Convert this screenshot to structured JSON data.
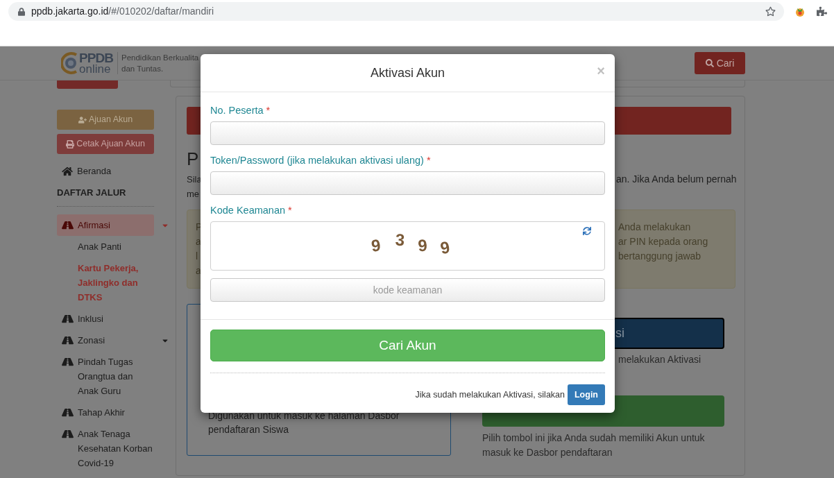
{
  "browser": {
    "url_host": "ppdb.jakarta.go.id",
    "url_path": "/#/010202/daftar/mandiri"
  },
  "header": {
    "logo_text": [
      "PPDB",
      "online"
    ],
    "tagline": [
      "Pendidikan Berkualita",
      "dan Tuntas."
    ],
    "search_button": "Cari"
  },
  "sidebar": {
    "buttons": [
      {
        "label": "Ajuan Akun",
        "kind": "warning"
      },
      {
        "label": "Cetak Ajuan Akun",
        "kind": "danger"
      }
    ],
    "home": "Beranda",
    "section_title": "DAFTAR JALUR",
    "items": [
      {
        "label": "Afirmasi",
        "selected": true,
        "expandable": true,
        "children": [
          {
            "label": "Anak Panti",
            "selected": false
          },
          {
            "label": "Kartu Pekerja, Jaklingko dan DTKS",
            "selected": true
          }
        ]
      },
      {
        "label": "Inklusi",
        "selected": false,
        "expandable": false
      },
      {
        "label": "Zonasi",
        "selected": false,
        "expandable": true
      },
      {
        "label": "Pindah Tugas Orangtua dan Anak Guru",
        "selected": false,
        "expandable": false
      },
      {
        "label": "Tahap Akhir",
        "selected": false,
        "expandable": false
      },
      {
        "label": "Anak Tenaga Kesehatan Korban Covid-19",
        "selected": false,
        "expandable": false
      }
    ]
  },
  "main": {
    "heading": "P",
    "intro_left": [
      "Sila",
      "me"
    ],
    "intro_right": "an. Jika Anda belum pernah",
    "alert_left": [
      "P",
      "a",
      "l",
      "a"
    ],
    "alert_right": [
      "Anda melakukan",
      "ar PIN kepada orang",
      "bertanggung jawab"
    ],
    "info_box": {
      "step_text": [
        "Digunakan untuk masuk ke halaman Dasbor",
        "pendaftaran Siswa"
      ]
    },
    "activation_button": "si",
    "activation_note": "melakukan Aktivasi",
    "login_note": [
      "Pilih tombol ini jika Anda sudah memiliki Akun untuk",
      "masuk ke Dasbor pendaftaran"
    ]
  },
  "modal": {
    "title": "Aktivasi Akun",
    "close": "×",
    "fields": [
      {
        "label": "No. Peserta",
        "marker": "*"
      },
      {
        "label": "Token/Password (jika melakukan aktivasi ulang)",
        "marker": "*"
      }
    ],
    "captcha": {
      "label": "Kode Keamanan",
      "marker": "*",
      "digits": [
        "9",
        "3",
        "9",
        "9"
      ],
      "placeholder": "kode keamanan"
    },
    "submit": "Cari Akun",
    "footer_text": "Jika sudah melakukan Aktivasi, silakan",
    "login": "Login"
  }
}
